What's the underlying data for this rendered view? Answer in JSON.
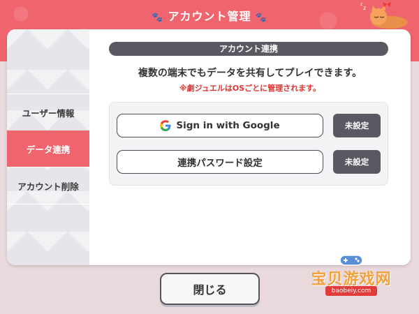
{
  "header": {
    "title": "アカウント管理",
    "paw_icon": "paw-icon"
  },
  "sidebar": {
    "items": [
      {
        "label": "ユーザー情報",
        "active": false
      },
      {
        "label": "データ連携",
        "active": true
      },
      {
        "label": "アカウント削除",
        "active": false
      }
    ]
  },
  "main": {
    "section_title": "アカウント連携",
    "description": "複数の端末でもデータを共有してプレイできます。",
    "note": "※劇ジュエルはOSごとに管理されます。",
    "google_button_label": "Sign in with Google",
    "google_status": "未設定",
    "password_button_label": "連携パスワード設定",
    "password_status": "未設定"
  },
  "footer": {
    "close_label": "閉じる"
  },
  "watermark": {
    "text": "宝贝游戏网",
    "url": "baobeiy.com"
  },
  "colors": {
    "accent": "#f0646e",
    "dark": "#5a5861",
    "note_red": "#e0322f"
  }
}
